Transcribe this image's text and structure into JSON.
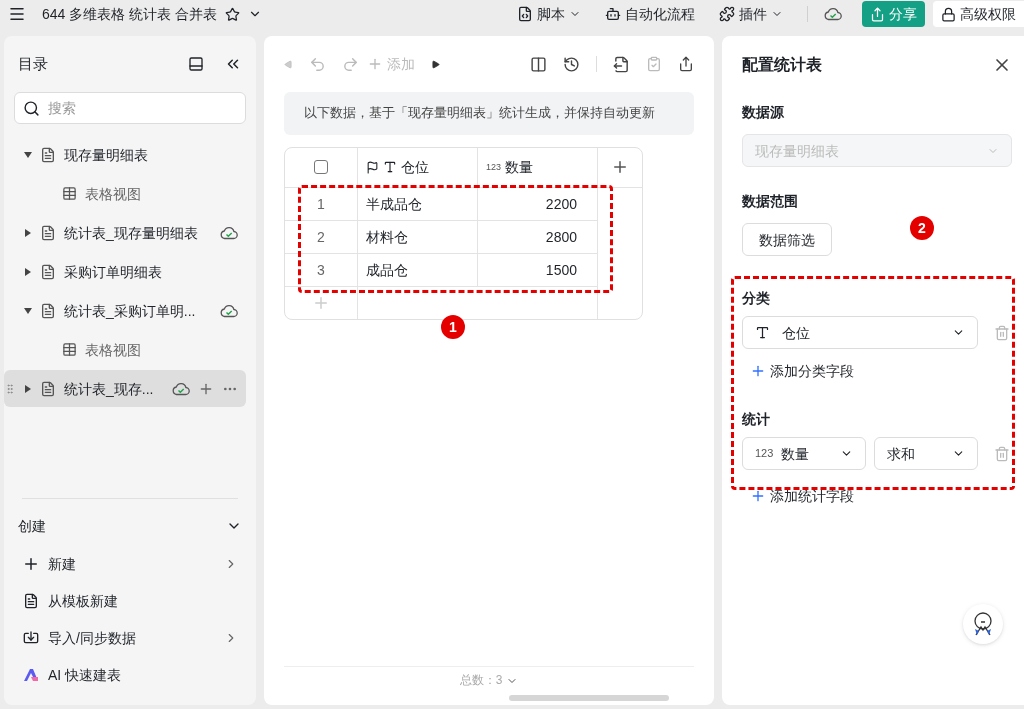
{
  "topbar": {
    "title": "644 多维表格 统计表 合并表",
    "menus": [
      "脚本",
      "自动化流程",
      "插件"
    ],
    "share": "分享",
    "permission": "高级权限"
  },
  "sidebar": {
    "title": "目录",
    "search": {
      "placeholder": "搜索"
    },
    "tree": [
      {
        "label": "现存量明细表",
        "expanded": true,
        "selected": false,
        "synced": false,
        "children": [
          {
            "label": "表格视图"
          }
        ]
      },
      {
        "label": "统计表_现存量明细表",
        "expanded": false,
        "selected": false,
        "synced": true
      },
      {
        "label": "采购订单明细表",
        "expanded": false,
        "selected": false,
        "synced": false
      },
      {
        "label": "统计表_采购订单明...",
        "expanded": true,
        "selected": false,
        "synced": true,
        "children": [
          {
            "label": "表格视图"
          }
        ]
      },
      {
        "label": "统计表_现存...",
        "expanded": false,
        "selected": true,
        "synced": true
      }
    ],
    "create": {
      "title": "创建",
      "items": [
        {
          "kind": "new",
          "label": "新建",
          "submenu": true
        },
        {
          "kind": "template",
          "label": "从模板新建",
          "submenu": false
        },
        {
          "kind": "import",
          "label": "导入/同步数据",
          "submenu": true
        },
        {
          "kind": "ai",
          "label": "AI 快速建表",
          "submenu": false
        }
      ]
    }
  },
  "view": {
    "add_label": "添加",
    "notice": "以下数据，基于「现存量明细表」统计生成，并保持自动更新",
    "table": {
      "select_all_checked": false,
      "columns": [
        {
          "kind": "text",
          "primary": true,
          "label": "仓位"
        },
        {
          "kind": "number",
          "primary": false,
          "type_label": "123",
          "label": "数量"
        }
      ],
      "rows": [
        {
          "index": "1",
          "cells": [
            "半成品仓",
            "2200"
          ]
        },
        {
          "index": "2",
          "cells": [
            "材料仓",
            "2800"
          ]
        },
        {
          "index": "3",
          "cells": [
            "成品仓",
            "1500"
          ]
        }
      ]
    },
    "footer": "总数：3"
  },
  "config": {
    "title": "配置统计表",
    "source": {
      "label": "数据源",
      "value": "现存量明细表",
      "disabled": true
    },
    "range": {
      "label": "数据范围",
      "button": "数据筛选"
    },
    "group": {
      "label": "分类",
      "field": "仓位",
      "add": "添加分类字段"
    },
    "stats": {
      "label": "统计",
      "type_label": "123",
      "field": "数量",
      "method": "求和",
      "add": "添加统计字段"
    }
  },
  "annotations": [
    {
      "label": "1"
    },
    {
      "label": "2"
    }
  ]
}
